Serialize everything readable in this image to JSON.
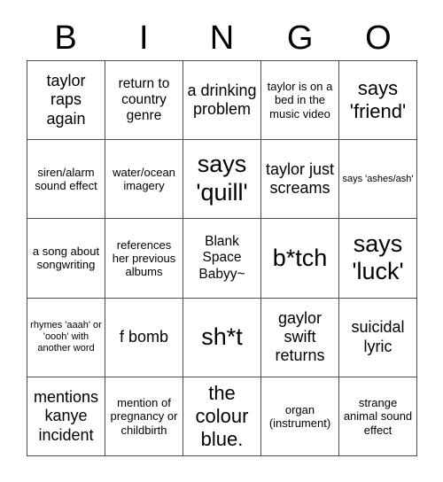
{
  "card": {
    "title": "BINGO",
    "header_letters": [
      "B",
      "I",
      "N",
      "G",
      "O"
    ],
    "grid_size": "5x5",
    "text_color": "#000000",
    "border_color": "#4d4d4d",
    "cell_background": "#ffffff",
    "rows": [
      [
        {
          "text": "taylor raps again",
          "size": "l"
        },
        {
          "text": "return to country genre",
          "size": "m"
        },
        {
          "text": "a drinking problem",
          "size": "l"
        },
        {
          "text": "taylor is on a bed in the music video",
          "size": "s"
        },
        {
          "text": "says 'friend'",
          "size": "xl"
        }
      ],
      [
        {
          "text": "siren/alarm sound effect",
          "size": "s"
        },
        {
          "text": "water/ocean imagery",
          "size": "s"
        },
        {
          "text": "says 'quill'",
          "size": "xxl"
        },
        {
          "text": "taylor just screams",
          "size": "l"
        },
        {
          "text": "says 'ashes/ash'",
          "size": "xs"
        }
      ],
      [
        {
          "text": "a song about songwriting",
          "size": "s"
        },
        {
          "text": "references her previous albums",
          "size": "s"
        },
        {
          "text": "Blank Space Babyy~",
          "size": "m"
        },
        {
          "text": "b*tch",
          "size": "xxl"
        },
        {
          "text": "says 'luck'",
          "size": "xxl"
        }
      ],
      [
        {
          "text": "rhymes 'aaah' or 'oooh' with another word",
          "size": "xs"
        },
        {
          "text": "f bomb",
          "size": "l"
        },
        {
          "text": "sh*t",
          "size": "xxl"
        },
        {
          "text": "gaylor swift returns",
          "size": "l"
        },
        {
          "text": "suicidal lyric",
          "size": "l"
        }
      ],
      [
        {
          "text": "mentions kanye incident",
          "size": "l"
        },
        {
          "text": "mention of pregnancy or childbirth",
          "size": "s"
        },
        {
          "text": "the colour blue.",
          "size": "xl"
        },
        {
          "text": "organ (instrument)",
          "size": "s"
        },
        {
          "text": "strange animal sound effect",
          "size": "s"
        }
      ]
    ]
  }
}
